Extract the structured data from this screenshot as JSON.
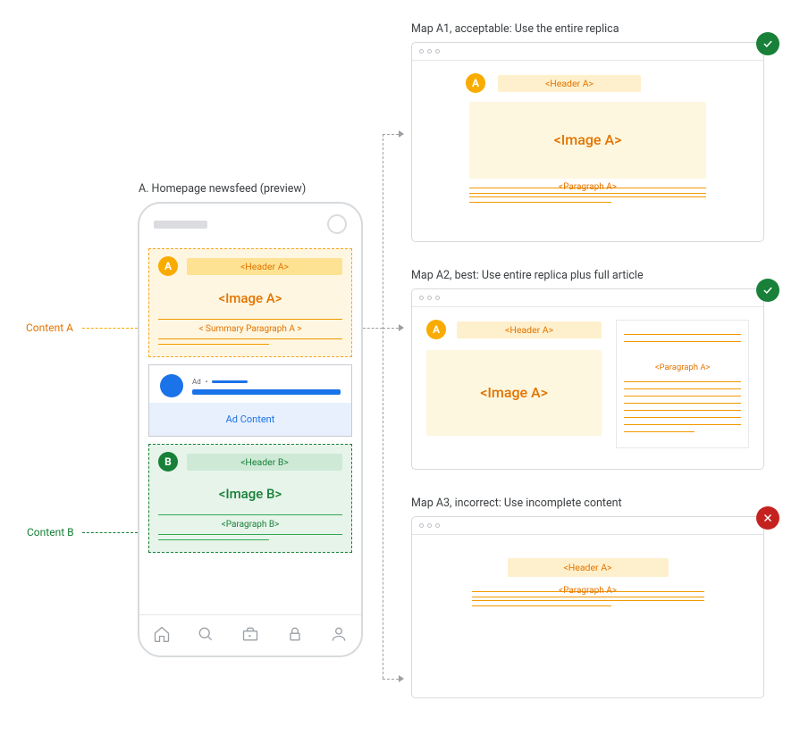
{
  "phone": {
    "label": "A. Homepage newsfeed (preview)",
    "contentA": {
      "badge": "A",
      "header": "<Header A>",
      "image": "<Image A>",
      "summary": "< Summary Paragraph A >"
    },
    "ad": {
      "tag": "Ad",
      "dot": "•",
      "content": "Ad Content"
    },
    "contentB": {
      "badge": "B",
      "header": "<Header B>",
      "image": "<Image B>",
      "paragraph": "<Paragraph B>"
    }
  },
  "sideLabels": {
    "a": "Content A",
    "b": "Content B"
  },
  "maps": {
    "a1": {
      "label": "Map A1, acceptable: Use the entire replica",
      "badge": "A",
      "header": "<Header A>",
      "image": "<Image A>",
      "paragraph": "<Paragraph A>",
      "status": "ok"
    },
    "a2": {
      "label": "Map A2, best: Use entire replica plus full article",
      "badge": "A",
      "header": "<Header A>",
      "image": "<Image A>",
      "paragraph": "<Paragraph A>",
      "status": "ok"
    },
    "a3": {
      "label": "Map A3, incorrect: Use incomplete content",
      "header": "<Header A>",
      "paragraph": "<Paragraph A>",
      "status": "bad"
    }
  }
}
